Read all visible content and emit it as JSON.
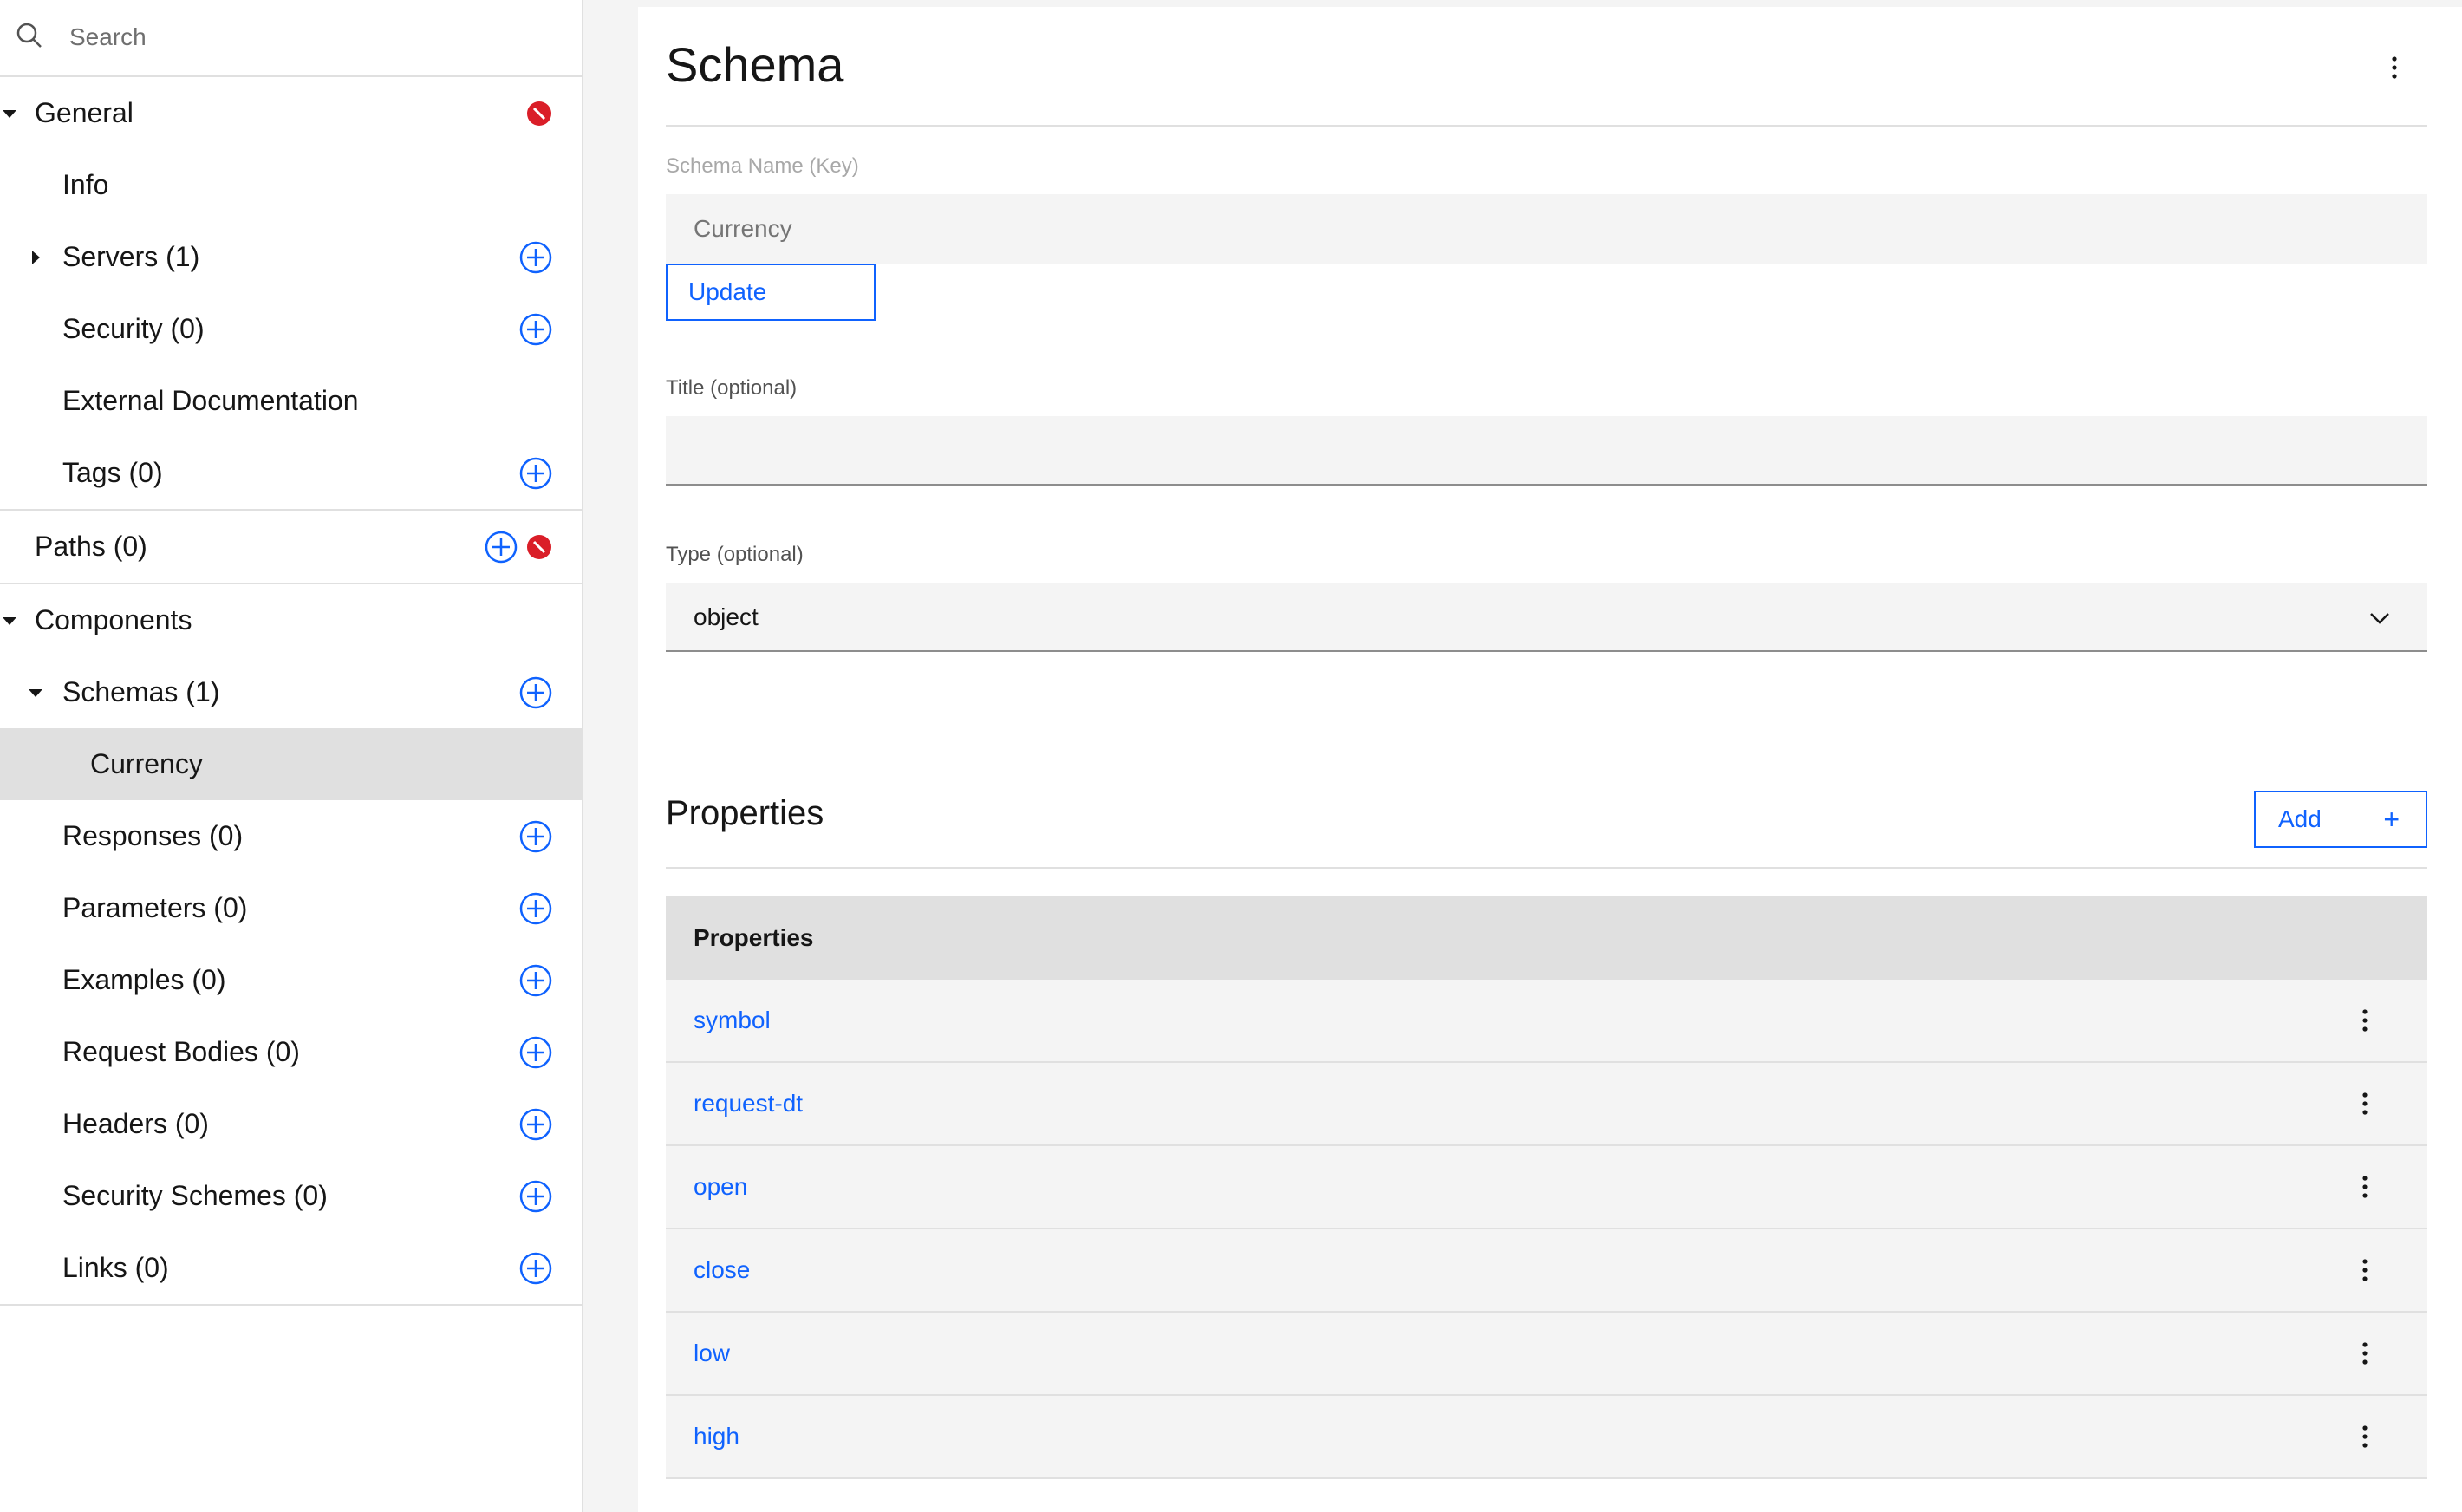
{
  "sidebar": {
    "search_placeholder": "Search",
    "general": {
      "label": "General",
      "items": [
        {
          "label": "Info"
        },
        {
          "label": "Servers (1)"
        },
        {
          "label": "Security (0)"
        },
        {
          "label": "External Documentation"
        },
        {
          "label": "Tags (0)"
        }
      ]
    },
    "paths": {
      "label": "Paths (0)"
    },
    "components": {
      "label": "Components",
      "schemas": {
        "label": "Schemas (1)",
        "children": [
          {
            "label": "Currency"
          }
        ]
      },
      "items": [
        {
          "label": "Responses (0)"
        },
        {
          "label": "Parameters (0)"
        },
        {
          "label": "Examples (0)"
        },
        {
          "label": "Request Bodies (0)"
        },
        {
          "label": "Headers (0)"
        },
        {
          "label": "Security Schemes (0)"
        },
        {
          "label": "Links (0)"
        }
      ]
    }
  },
  "main": {
    "title": "Schema",
    "schema_name": {
      "label": "Schema Name (Key)",
      "placeholder": "Currency",
      "update_label": "Update"
    },
    "title_field": {
      "label": "Title (optional)",
      "value": ""
    },
    "type_field": {
      "label": "Type (optional)",
      "value": "object"
    },
    "properties": {
      "heading": "Properties",
      "add_label": "Add",
      "add_symbol": "+",
      "table_header": "Properties",
      "rows": [
        {
          "name": "symbol"
        },
        {
          "name": "request-dt"
        },
        {
          "name": "open"
        },
        {
          "name": "close"
        },
        {
          "name": "low"
        },
        {
          "name": "high"
        }
      ]
    }
  },
  "colors": {
    "accent": "#0f62fe",
    "error": "#da1e28",
    "selected_bg": "#e0e0e0"
  }
}
